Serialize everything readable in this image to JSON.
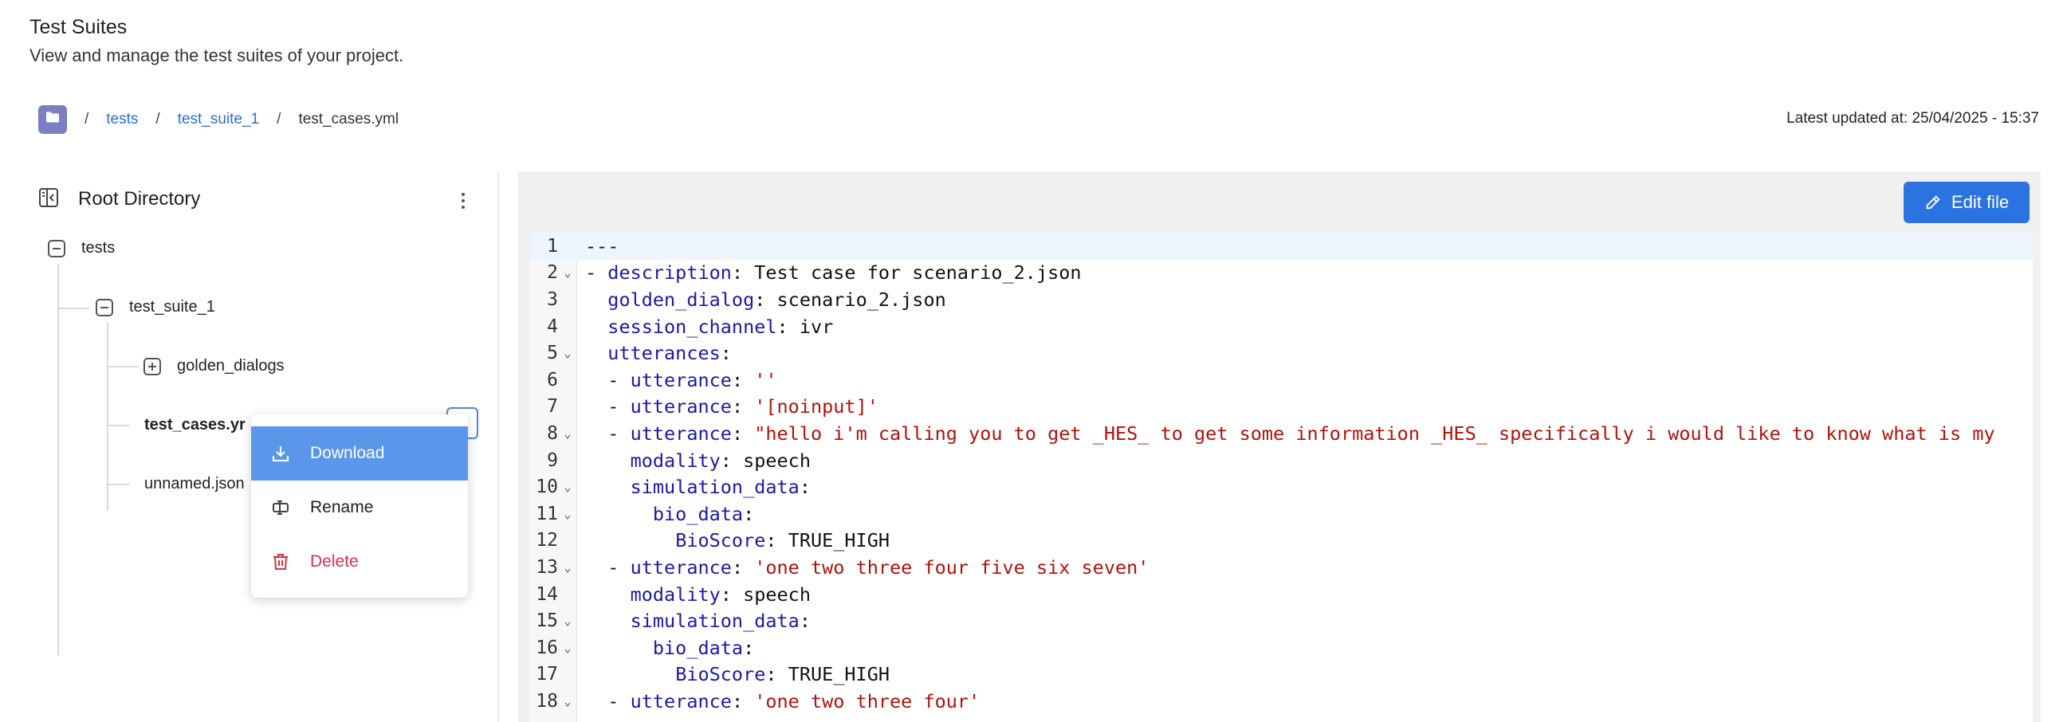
{
  "header": {
    "title": "Test Suites",
    "subtitle": "View and manage the test suites of your project."
  },
  "breadcrumb": {
    "home_icon": "folder-icon",
    "items": [
      "tests",
      "test_suite_1",
      "test_cases.yml"
    ],
    "separator": "/"
  },
  "updated": {
    "label": "Latest updated at:",
    "value": "25/04/2025 - 15:37"
  },
  "sidebar": {
    "title": "Root Directory",
    "tree": {
      "root": "tests",
      "suite": "test_suite_1",
      "folder": "golden_dialogs",
      "file_selected": "test_cases.yml",
      "file_selected_display": "test_cases.yr",
      "file_other": "unnamed.json"
    }
  },
  "context_menu": {
    "download": "Download",
    "rename": "Rename",
    "delete": "Delete"
  },
  "editor": {
    "edit_button": "Edit file",
    "lines": [
      {
        "n": "1",
        "fold": false,
        "text": "---"
      },
      {
        "n": "2",
        "fold": true,
        "text": "- description: Test case for scenario_2.json"
      },
      {
        "n": "3",
        "fold": false,
        "text": "  golden_dialog: scenario_2.json"
      },
      {
        "n": "4",
        "fold": false,
        "text": "  session_channel: ivr"
      },
      {
        "n": "5",
        "fold": true,
        "text": "  utterances:"
      },
      {
        "n": "6",
        "fold": false,
        "text": "  - utterance: ''"
      },
      {
        "n": "7",
        "fold": false,
        "text": "  - utterance: '[noinput]'"
      },
      {
        "n": "8",
        "fold": true,
        "text": "  - utterance: \"hello i'm calling you to get _HES_ to get some information _HES_ specifically i would like to know what is my"
      },
      {
        "n": "9",
        "fold": false,
        "text": "    modality: speech"
      },
      {
        "n": "10",
        "fold": true,
        "text": "    simulation_data:"
      },
      {
        "n": "11",
        "fold": true,
        "text": "      bio_data:"
      },
      {
        "n": "12",
        "fold": false,
        "text": "        BioScore: TRUE_HIGH"
      },
      {
        "n": "13",
        "fold": true,
        "text": "  - utterance: 'one two three four five six seven'"
      },
      {
        "n": "14",
        "fold": false,
        "text": "    modality: speech"
      },
      {
        "n": "15",
        "fold": true,
        "text": "    simulation_data:"
      },
      {
        "n": "16",
        "fold": true,
        "text": "      bio_data:"
      },
      {
        "n": "17",
        "fold": false,
        "text": "        BioScore: TRUE_HIGH"
      },
      {
        "n": "18",
        "fold": true,
        "text": "  - utterance: 'one two three four'"
      }
    ]
  },
  "colors": {
    "accent": "#2a73e0",
    "menu_active": "#5a97eb",
    "danger": "#d6304a",
    "yaml_key": "#1a1aa6",
    "yaml_string": "#b0120a"
  }
}
